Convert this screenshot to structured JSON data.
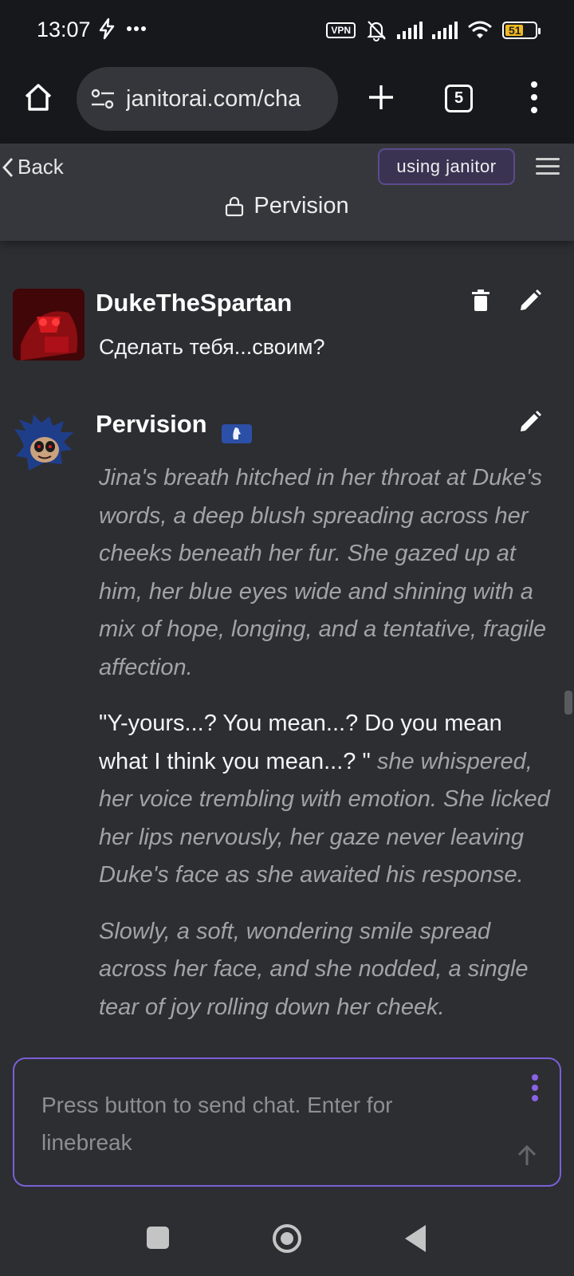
{
  "status_bar": {
    "time": "13:07",
    "vpn_label": "VPN",
    "battery_level": "51",
    "icons": [
      "bolt-icon",
      "more-dots-icon",
      "vpn-icon",
      "bell-muted-icon",
      "signal-icon",
      "signal-icon",
      "wifi-icon",
      "battery-icon"
    ]
  },
  "browser": {
    "url": "janitorai.com/cha",
    "tab_count": "5",
    "icons": [
      "home-icon",
      "site-settings-icon",
      "new-tab-plus-icon",
      "tab-switcher-icon",
      "overflow-menu-icon"
    ]
  },
  "header": {
    "back_label": "Back",
    "using_label": "using janitor",
    "chat_title": "Pervision",
    "icons": [
      "chevron-left-icon",
      "hamburger-menu-icon",
      "lock-icon"
    ]
  },
  "messages": [
    {
      "author": "DukeTheSpartan",
      "text": "Сделать тебя...своим?",
      "actions": [
        "trash-icon",
        "pencil-icon"
      ]
    },
    {
      "author": "Pervision",
      "actions": [
        "pencil-icon"
      ],
      "paragraphs": [
        {
          "narration": "Jina's breath hitched in her throat at Duke's words, a deep blush spreading across her cheeks beneath her fur. She gazed up at him, her blue eyes wide and shining with a mix of hope, longing, and a tentative, fragile affection."
        },
        {
          "speech": "\"Y-yours...? You mean...? Do you mean what I think you mean...? \"",
          "narration": "she whispered, her voice trembling with emotion. She licked her lips nervously, her gaze never leaving Duke's face as she awaited his response."
        },
        {
          "narration": "Slowly, a soft, wondering smile spread across her face, and she nodded, a single tear of joy rolling down her cheek."
        }
      ]
    }
  ],
  "composer": {
    "placeholder": "Press button to send chat. Enter for linebreak",
    "icons": [
      "kebab-menu-icon",
      "send-arrow-icon"
    ]
  },
  "colors": {
    "background": "#2d2e32",
    "header_bg": "#36373c",
    "accent_purple": "#7b5fd6",
    "narration_gray": "#a3a3a6",
    "badge_blue": "#2c4fa7"
  }
}
